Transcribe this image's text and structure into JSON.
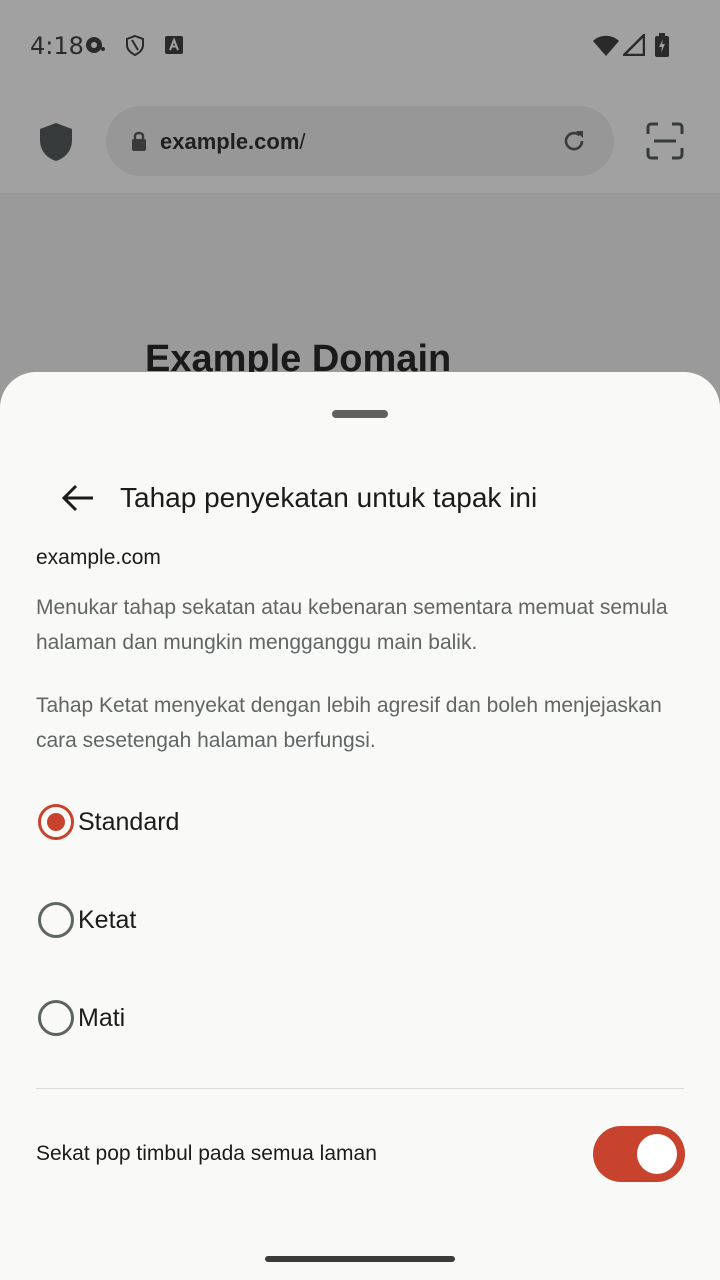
{
  "status_bar": {
    "time": "4:18",
    "icons": [
      "media-icon",
      "shield-outline-icon",
      "font-a-icon",
      "wifi-icon",
      "signal-icon",
      "battery-charging-icon"
    ]
  },
  "browser": {
    "url_domain": "example.com",
    "url_path": "/",
    "icons": [
      "privacy-shield-icon",
      "lock-icon",
      "reload-icon",
      "scan-icon"
    ]
  },
  "web_page": {
    "heading": "Example Domain"
  },
  "sheet": {
    "title": "Tahap penyekatan untuk tapak ini",
    "site": "example.com",
    "description_1": "Menukar tahap sekatan atau kebenaran sementara memuat semula halaman dan mungkin mengganggu main balik.",
    "description_2": "Tahap Ketat menyekat dengan lebih agresif dan boleh menjejaskan cara sesetengah halaman berfungsi.",
    "options": [
      {
        "label": "Standard",
        "selected": true
      },
      {
        "label": "Ketat",
        "selected": false
      },
      {
        "label": "Mati",
        "selected": false
      }
    ],
    "popup_toggle": {
      "label": "Sekat pop timbul pada semua laman",
      "on": true
    }
  },
  "colors": {
    "accent": "#c8432d",
    "sheet_background": "#f9f9f7",
    "scrim": "#9a9a9a"
  }
}
